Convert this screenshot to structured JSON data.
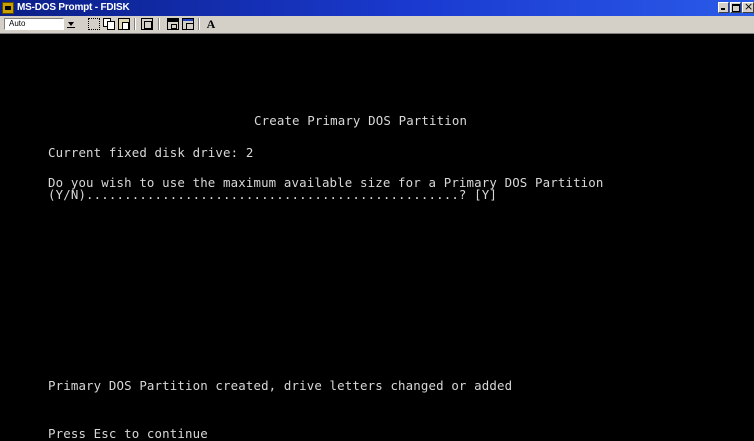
{
  "window": {
    "title": "MS-DOS Prompt - FDISK"
  },
  "toolbar": {
    "font_size": "Auto",
    "icons": [
      "mark-icon",
      "copy-icon",
      "paste-icon",
      "fullscreen-icon",
      "properties-icon",
      "background-icon",
      "font-icon"
    ],
    "font_button_label": "A"
  },
  "console": {
    "heading": "Create Primary DOS Partition",
    "current_drive": "Current fixed disk drive: 2",
    "prompt_line1": "Do you wish to use the maximum available size for a Primary DOS Partition",
    "prompt_line2": "(Y/N).................................................? [Y]",
    "status": "Primary DOS Partition created, drive letters changed or added",
    "continue_hint": "Press Esc to continue"
  },
  "colors": {
    "console_bg": "#000000",
    "console_text": "#d8d8d8",
    "titlebar": "#0b1f86",
    "toolbar_bg": "#d4d0c8"
  }
}
